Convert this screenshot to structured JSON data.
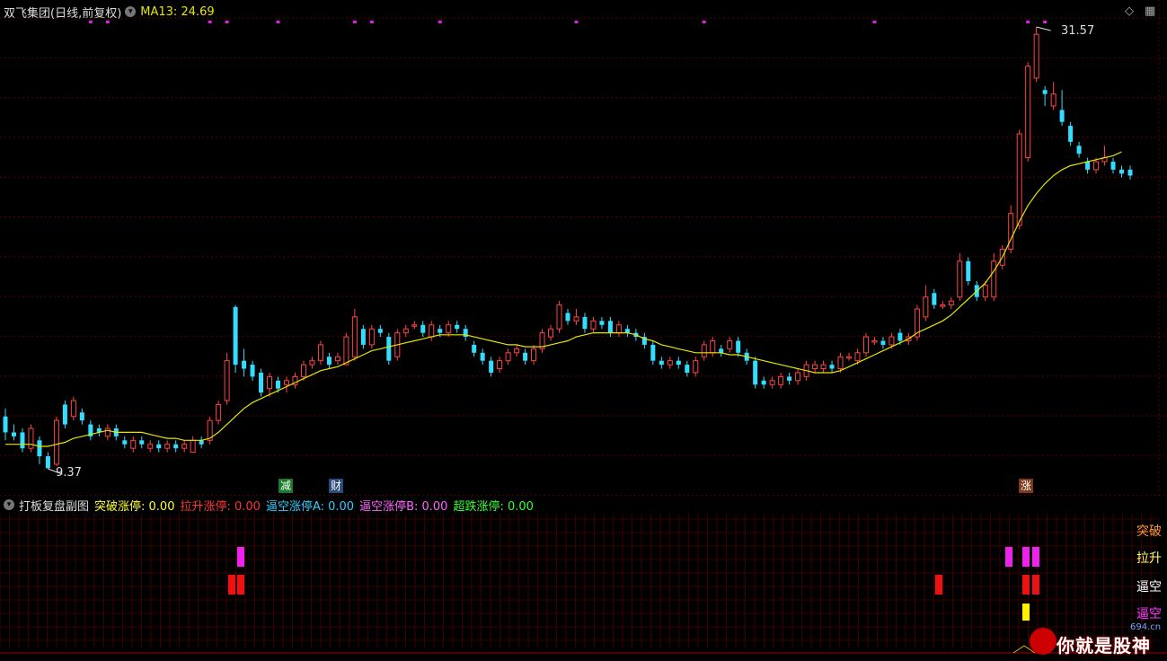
{
  "header": {
    "stock_title": "双飞集团(日线,前复权)",
    "indicator_label": "MA13: 24.69"
  },
  "main_chart": {
    "high_label": "31.57",
    "low_label": "9.37",
    "events": [
      {
        "label": "减",
        "color": "#1a7a2a"
      },
      {
        "label": "财",
        "color": "#2a4a7a"
      },
      {
        "label": "涨",
        "color": "#7a3a1a"
      }
    ]
  },
  "sub_header": {
    "title": "打板复盘副图",
    "items": [
      {
        "label": "突破涨停: 0.00",
        "color": "#ffff33"
      },
      {
        "label": "拉升涨停: 0.00",
        "color": "#ff3333"
      },
      {
        "label": "逼空涨停A: 0.00",
        "color": "#33ccff"
      },
      {
        "label": "逼空涨停B: 0.00",
        "color": "#ff66ff"
      },
      {
        "label": "超跌涨停: 0.00",
        "color": "#33ff33"
      }
    ]
  },
  "sub_labels": [
    {
      "label": "突破",
      "color": "#ff9933"
    },
    {
      "label": "拉升",
      "color": "#ffff66"
    },
    {
      "label": "逼空",
      "color": "#ffffff"
    },
    {
      "label": "逼空",
      "color": "#ff33ff"
    }
  ],
  "colors": {
    "up": "#ff4444",
    "down": "#33ddff",
    "ma": "#e6e600",
    "grid": "#5a0000"
  },
  "watermark": {
    "text": "你就是股神",
    "site": "694.cn"
  },
  "chart_data": {
    "type": "candlestick",
    "title": "双飞集团(日线,前复权)",
    "high_marker": 31.57,
    "low_marker": 9.37,
    "ma13_last": 24.69,
    "candles": [
      [
        12.0,
        11.2,
        12.4,
        10.8
      ],
      [
        11.2,
        11.0,
        11.6,
        10.8
      ],
      [
        11.2,
        10.4,
        11.4,
        10.2
      ],
      [
        10.4,
        11.4,
        11.6,
        10.2
      ],
      [
        10.8,
        10.0,
        11.0,
        9.6
      ],
      [
        10.0,
        9.4,
        10.2,
        9.37
      ],
      [
        9.6,
        11.8,
        12.0,
        9.5
      ],
      [
        12.6,
        11.6,
        12.8,
        11.4
      ],
      [
        12.0,
        12.8,
        13.0,
        11.8
      ],
      [
        12.2,
        11.8,
        12.4,
        11.6
      ],
      [
        11.6,
        11.0,
        11.8,
        10.8
      ],
      [
        11.4,
        11.2,
        11.6,
        11.0
      ],
      [
        11.0,
        11.4,
        11.6,
        10.8
      ],
      [
        11.4,
        11.0,
        11.6,
        10.8
      ],
      [
        10.8,
        10.6,
        11.0,
        10.4
      ],
      [
        10.4,
        10.8,
        11.0,
        10.2
      ],
      [
        10.8,
        10.6,
        11.0,
        10.4
      ],
      [
        10.4,
        10.6,
        10.8,
        10.2
      ],
      [
        10.6,
        10.4,
        10.8,
        10.2
      ],
      [
        10.4,
        10.6,
        10.8,
        10.2
      ],
      [
        10.6,
        10.4,
        10.8,
        10.2
      ],
      [
        10.4,
        10.6,
        10.8,
        10.2
      ],
      [
        10.2,
        10.8,
        11.0,
        10.2
      ],
      [
        10.8,
        10.6,
        11.0,
        10.4
      ],
      [
        10.8,
        11.8,
        12.0,
        10.6
      ],
      [
        11.8,
        12.6,
        12.8,
        11.6
      ],
      [
        12.8,
        14.8,
        15.2,
        12.6
      ],
      [
        17.5,
        14.6,
        17.6,
        14.2
      ],
      [
        14.8,
        14.4,
        15.4,
        14.0
      ],
      [
        14.6,
        14.0,
        14.8,
        13.8
      ],
      [
        14.2,
        13.2,
        14.4,
        13.0
      ],
      [
        13.4,
        14.0,
        14.2,
        13.0
      ],
      [
        13.8,
        13.4,
        14.0,
        13.2
      ],
      [
        13.6,
        13.8,
        14.0,
        13.2
      ],
      [
        13.6,
        14.0,
        14.2,
        13.4
      ],
      [
        14.0,
        14.6,
        14.8,
        13.8
      ],
      [
        14.6,
        14.8,
        15.0,
        14.4
      ],
      [
        14.8,
        15.6,
        15.8,
        14.6
      ],
      [
        15.0,
        14.6,
        15.2,
        14.4
      ],
      [
        14.8,
        15.0,
        15.2,
        14.6
      ],
      [
        14.6,
        16.0,
        16.2,
        14.6
      ],
      [
        15.0,
        17.0,
        17.4,
        14.8
      ],
      [
        16.4,
        15.6,
        16.6,
        15.4
      ],
      [
        15.6,
        16.4,
        16.6,
        15.4
      ],
      [
        16.4,
        16.2,
        16.6,
        16.0
      ],
      [
        16.0,
        14.8,
        16.2,
        14.6
      ],
      [
        15.0,
        16.2,
        16.4,
        14.8
      ],
      [
        16.2,
        16.4,
        16.6,
        16.0
      ],
      [
        16.6,
        16.6,
        16.8,
        16.4
      ],
      [
        16.6,
        16.2,
        16.8,
        16.0
      ],
      [
        16.0,
        16.6,
        16.8,
        15.8
      ],
      [
        16.4,
        16.2,
        16.6,
        16.0
      ],
      [
        16.2,
        16.6,
        16.8,
        16.0
      ],
      [
        16.6,
        16.4,
        16.8,
        16.2
      ],
      [
        16.4,
        16.0,
        16.6,
        15.8
      ],
      [
        15.6,
        15.2,
        15.8,
        15.0
      ],
      [
        15.2,
        14.8,
        15.4,
        14.6
      ],
      [
        14.8,
        14.2,
        15.0,
        14.0
      ],
      [
        14.4,
        14.8,
        15.0,
        14.2
      ],
      [
        14.8,
        15.2,
        15.4,
        14.6
      ],
      [
        15.2,
        15.4,
        15.6,
        15.0
      ],
      [
        15.2,
        14.8,
        15.4,
        14.6
      ],
      [
        14.8,
        15.4,
        15.6,
        14.6
      ],
      [
        15.4,
        16.2,
        16.4,
        15.2
      ],
      [
        16.0,
        16.4,
        16.6,
        15.8
      ],
      [
        16.4,
        17.6,
        17.8,
        16.2
      ],
      [
        17.2,
        16.8,
        17.4,
        16.6
      ],
      [
        16.8,
        17.0,
        17.4,
        16.6
      ],
      [
        17.0,
        16.4,
        17.2,
        16.2
      ],
      [
        16.4,
        16.8,
        17.0,
        16.2
      ],
      [
        16.8,
        16.6,
        17.0,
        16.4
      ],
      [
        16.8,
        16.2,
        17.0,
        16.0
      ],
      [
        16.2,
        16.6,
        16.8,
        16.0
      ],
      [
        16.4,
        16.2,
        16.6,
        16.0
      ],
      [
        16.2,
        16.0,
        16.4,
        15.8
      ],
      [
        16.0,
        15.6,
        16.2,
        15.4
      ],
      [
        15.6,
        14.8,
        15.8,
        14.6
      ],
      [
        14.8,
        14.6,
        15.0,
        14.4
      ],
      [
        14.6,
        14.8,
        15.0,
        14.4
      ],
      [
        14.8,
        14.6,
        15.0,
        14.4
      ],
      [
        14.6,
        14.2,
        14.8,
        14.0
      ],
      [
        14.2,
        14.8,
        15.0,
        14.0
      ],
      [
        15.0,
        15.6,
        15.8,
        14.8
      ],
      [
        15.2,
        15.8,
        16.0,
        15.0
      ],
      [
        15.4,
        15.2,
        15.6,
        15.0
      ],
      [
        15.4,
        15.8,
        16.0,
        15.2
      ],
      [
        15.8,
        15.2,
        16.0,
        15.0
      ],
      [
        15.2,
        14.8,
        15.4,
        14.6
      ],
      [
        14.8,
        13.6,
        15.0,
        13.4
      ],
      [
        13.8,
        13.6,
        14.0,
        13.4
      ],
      [
        13.6,
        13.8,
        14.0,
        13.4
      ],
      [
        13.6,
        14.0,
        14.2,
        13.4
      ],
      [
        14.0,
        13.8,
        14.2,
        13.6
      ],
      [
        13.8,
        14.2,
        14.4,
        13.6
      ],
      [
        14.0,
        14.6,
        14.8,
        13.8
      ],
      [
        14.4,
        14.6,
        14.8,
        14.2
      ],
      [
        14.4,
        14.6,
        14.8,
        14.2
      ],
      [
        14.6,
        14.4,
        14.8,
        14.2
      ],
      [
        14.4,
        15.0,
        15.2,
        14.2
      ],
      [
        15.0,
        15.0,
        15.2,
        14.8
      ],
      [
        14.8,
        15.2,
        15.4,
        14.6
      ],
      [
        15.2,
        16.0,
        16.2,
        15.0
      ],
      [
        15.8,
        15.8,
        16.0,
        15.6
      ],
      [
        15.8,
        15.6,
        16.0,
        15.4
      ],
      [
        15.6,
        16.0,
        16.2,
        15.4
      ],
      [
        16.2,
        15.8,
        16.4,
        15.6
      ],
      [
        15.8,
        16.0,
        16.2,
        15.6
      ],
      [
        16.0,
        17.4,
        17.6,
        15.8
      ],
      [
        17.0,
        18.0,
        18.6,
        16.8
      ],
      [
        18.2,
        17.6,
        18.4,
        17.4
      ],
      [
        17.6,
        17.6,
        17.8,
        17.4
      ],
      [
        17.6,
        17.8,
        18.0,
        17.4
      ],
      [
        18.0,
        19.8,
        20.2,
        17.8
      ],
      [
        19.8,
        18.8,
        20.0,
        18.6
      ],
      [
        18.6,
        18.0,
        18.8,
        17.8
      ],
      [
        18.0,
        18.6,
        18.8,
        17.8
      ],
      [
        18.0,
        19.8,
        20.2,
        17.8
      ],
      [
        19.6,
        20.4,
        20.6,
        19.4
      ],
      [
        20.4,
        22.2,
        22.6,
        20.2
      ],
      [
        21.6,
        26.2,
        26.4,
        21.4
      ],
      [
        25.0,
        29.6,
        29.8,
        24.8
      ],
      [
        29.0,
        31.2,
        31.57,
        28.8
      ],
      [
        28.4,
        28.2,
        28.6,
        27.6
      ],
      [
        27.6,
        28.2,
        28.8,
        27.4
      ],
      [
        27.4,
        26.8,
        28.4,
        26.6
      ],
      [
        26.6,
        25.8,
        26.8,
        25.6
      ],
      [
        25.6,
        25.2,
        25.8,
        25.0
      ],
      [
        24.8,
        24.4,
        25.0,
        24.2
      ],
      [
        24.4,
        24.8,
        25.0,
        24.2
      ],
      [
        24.8,
        25.0,
        25.6,
        24.6
      ],
      [
        24.8,
        24.4,
        25.0,
        24.2
      ],
      [
        24.4,
        24.2,
        24.6,
        24.0
      ],
      [
        24.4,
        24.1,
        24.6,
        23.9
      ]
    ],
    "ma13": [
      10.6,
      10.6,
      10.6,
      10.6,
      10.5,
      10.5,
      10.6,
      10.7,
      10.9,
      11.0,
      11.1,
      11.2,
      11.3,
      11.2,
      11.2,
      11.2,
      11.2,
      11.1,
      11.0,
      10.9,
      10.9,
      10.8,
      10.8,
      10.8,
      10.9,
      11.2,
      11.6,
      12.0,
      12.4,
      12.7,
      12.9,
      13.1,
      13.3,
      13.5,
      13.7,
      13.9,
      14.1,
      14.3,
      14.4,
      14.5,
      14.7,
      14.9,
      15.1,
      15.3,
      15.4,
      15.5,
      15.6,
      15.7,
      15.8,
      15.9,
      16.0,
      16.1,
      16.1,
      16.1,
      16.1,
      16.0,
      15.9,
      15.8,
      15.7,
      15.6,
      15.6,
      15.5,
      15.5,
      15.5,
      15.6,
      15.7,
      15.8,
      16.0,
      16.1,
      16.2,
      16.2,
      16.2,
      16.2,
      16.2,
      16.1,
      15.9,
      15.8,
      15.6,
      15.5,
      15.4,
      15.3,
      15.2,
      15.2,
      15.2,
      15.2,
      15.1,
      15.1,
      15.0,
      14.9,
      14.8,
      14.7,
      14.6,
      14.5,
      14.4,
      14.3,
      14.2,
      14.2,
      14.2,
      14.3,
      14.5,
      14.7,
      14.9,
      15.1,
      15.3,
      15.5,
      15.7,
      15.9,
      16.2,
      16.4,
      16.6,
      16.8,
      17.1,
      17.5,
      17.9,
      18.3,
      18.7,
      19.3,
      20.0,
      20.9,
      21.8,
      22.6,
      23.2,
      23.7,
      24.1,
      24.4,
      24.6,
      24.7,
      24.8,
      24.9,
      25.0,
      25.1,
      25.3
    ]
  }
}
